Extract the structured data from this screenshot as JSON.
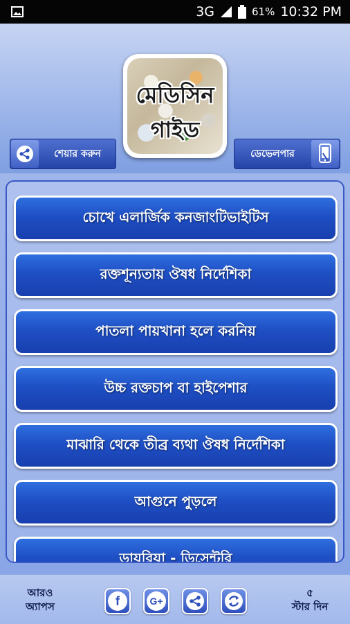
{
  "status_bar": {
    "network": "3G",
    "battery_percent": "61%",
    "time": "10:32 PM"
  },
  "header": {
    "logo_line1": "মেডিসিন",
    "logo_line2": "গাইড",
    "share_label": "শেয়ার করুন",
    "developer_label": "ডেভেলপার"
  },
  "list": {
    "items": [
      {
        "label": "চোখে এলার্জিক কনজাংটিভাইটিস"
      },
      {
        "label": "রক্তশূন্যতায় ঔষধ নির্দেশিকা"
      },
      {
        "label": "পাতলা পায়খানা হলে করনিয়"
      },
      {
        "label": "উচ্চ রক্তচাপ বা হাইপেশার"
      },
      {
        "label": "মাঝারি থেকে তীব্র ব্যথা ঔষধ নির্দেশিকা"
      },
      {
        "label": "আগুনে পুড়লে"
      },
      {
        "label": "ডায়রিয়া - ডিসেন্টরি"
      }
    ]
  },
  "bottom_bar": {
    "more_apps_line1": "আরও",
    "more_apps_line2": "অ্যাপস",
    "rate_line1": "৫",
    "rate_line2": "স্টার দিন",
    "icons": [
      "facebook-icon",
      "google-plus-icon",
      "share-icon",
      "refresh-icon"
    ]
  },
  "colors": {
    "header_bg": "#9fb7ea",
    "button_blue": "#1e4fc4",
    "status_bar_bg": "#050505"
  }
}
